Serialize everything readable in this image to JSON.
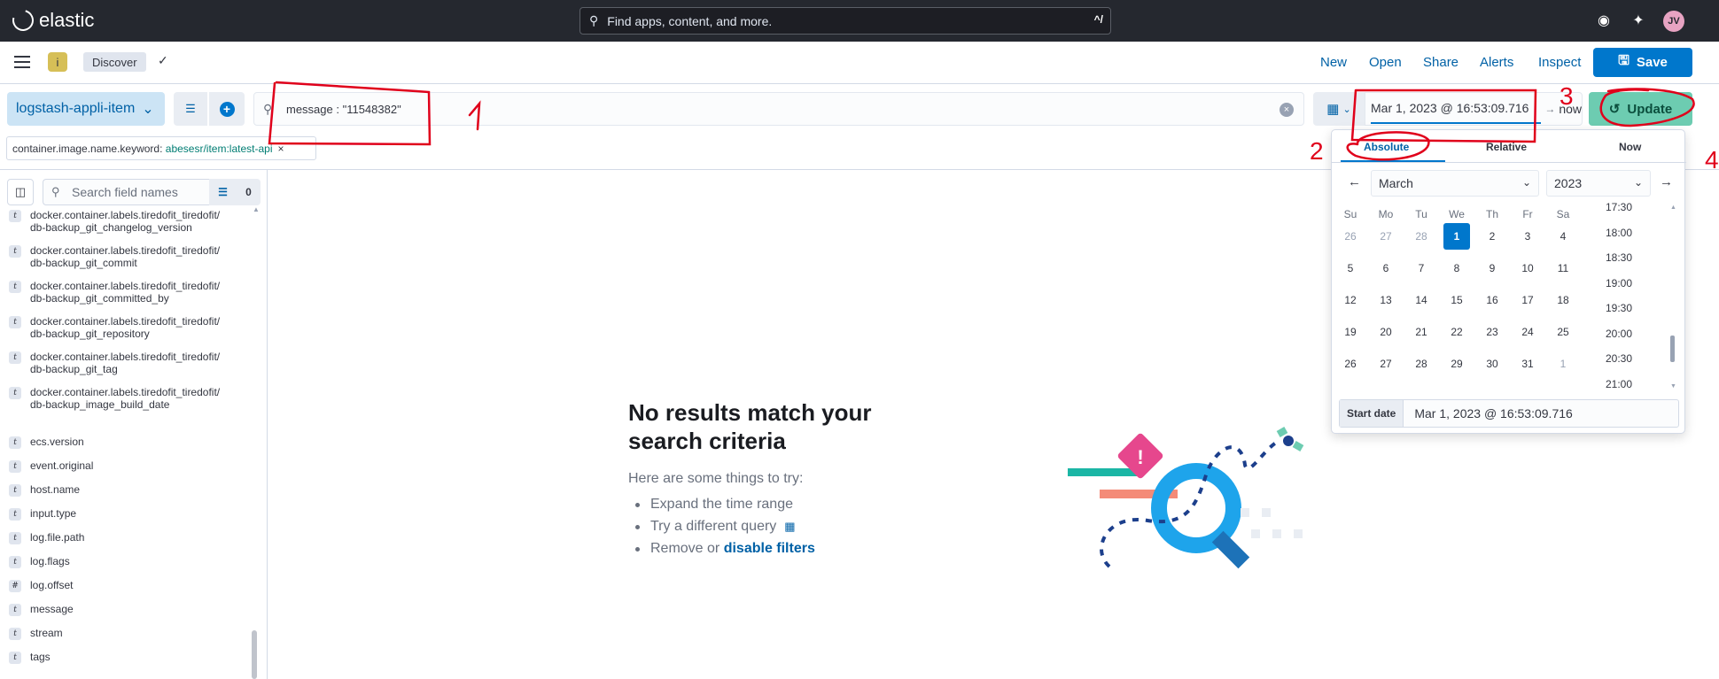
{
  "header": {
    "brand": "elastic",
    "search_placeholder": "Find apps, content, and more.",
    "search_shortcut": "^/",
    "avatar_initials": "JV"
  },
  "nav": {
    "space_initial": "i",
    "breadcrumb": "Discover",
    "links": [
      "New",
      "Open",
      "Share",
      "Alerts",
      "Inspect"
    ],
    "save_label": "Save"
  },
  "query_bar": {
    "data_view": "logstash-appli-item",
    "query": "message : \"11548382\"",
    "date_start": "Mar 1, 2023 @ 16:53:09.716",
    "date_end": "now",
    "update_label": "Update"
  },
  "filter_pill": {
    "field": "container.image.name.keyword:",
    "value": "abesesr/item:latest-api"
  },
  "sidebar": {
    "search_placeholder": "Search field names",
    "filter_count": "0",
    "fields": [
      {
        "type": "t",
        "name": "docker.container.labels.tiredofit_tiredofit/db-backup_git_changelog_version"
      },
      {
        "type": "t",
        "name": "docker.container.labels.tiredofit_tiredofit/db-backup_git_commit"
      },
      {
        "type": "t",
        "name": "docker.container.labels.tiredofit_tiredofit/db-backup_git_committed_by"
      },
      {
        "type": "t",
        "name": "docker.container.labels.tiredofit_tiredofit/db-backup_git_repository"
      },
      {
        "type": "t",
        "name": "docker.container.labels.tiredofit_tiredofit/db-backup_git_tag"
      },
      {
        "type": "t",
        "name": "docker.container.labels.tiredofit_tiredofit/db-backup_image_build_date"
      },
      {
        "type": "t",
        "name": "ecs.version"
      },
      {
        "type": "t",
        "name": "event.original"
      },
      {
        "type": "t",
        "name": "host.name"
      },
      {
        "type": "t",
        "name": "input.type"
      },
      {
        "type": "t",
        "name": "log.file.path"
      },
      {
        "type": "t",
        "name": "log.flags"
      },
      {
        "type": "#",
        "name": "log.offset"
      },
      {
        "type": "t",
        "name": "message"
      },
      {
        "type": "t",
        "name": "stream"
      },
      {
        "type": "t",
        "name": "tags"
      }
    ]
  },
  "empty_state": {
    "title": "No results match your search criteria",
    "subtitle": "Here are some things to try:",
    "tips": [
      "Expand the time range",
      "Try a different query",
      "Remove or"
    ],
    "disable_filters_link": "disable filters"
  },
  "date_picker": {
    "tabs": [
      "Absolute",
      "Relative",
      "Now"
    ],
    "month": "March",
    "year": "2023",
    "weekdays": [
      "Su",
      "Mo",
      "Tu",
      "We",
      "Th",
      "Fr",
      "Sa"
    ],
    "weeks": [
      [
        "26",
        "27",
        "28",
        "1",
        "2",
        "3",
        "4"
      ],
      [
        "5",
        "6",
        "7",
        "8",
        "9",
        "10",
        "11"
      ],
      [
        "12",
        "13",
        "14",
        "15",
        "16",
        "17",
        "18"
      ],
      [
        "19",
        "20",
        "21",
        "22",
        "23",
        "24",
        "25"
      ],
      [
        "26",
        "27",
        "28",
        "29",
        "30",
        "31",
        "1"
      ]
    ],
    "selected_day": "1",
    "times": [
      "17:30",
      "18:00",
      "18:30",
      "19:00",
      "19:30",
      "20:00",
      "20:30",
      "21:00"
    ],
    "start_label": "Start date",
    "start_value": "Mar 1, 2023 @ 16:53:09.716"
  },
  "annotations": [
    "1",
    "2",
    "3",
    "4"
  ],
  "colors": {
    "primary": "#0077cc",
    "update": "#6dccb1",
    "annotation": "#e0001b"
  }
}
